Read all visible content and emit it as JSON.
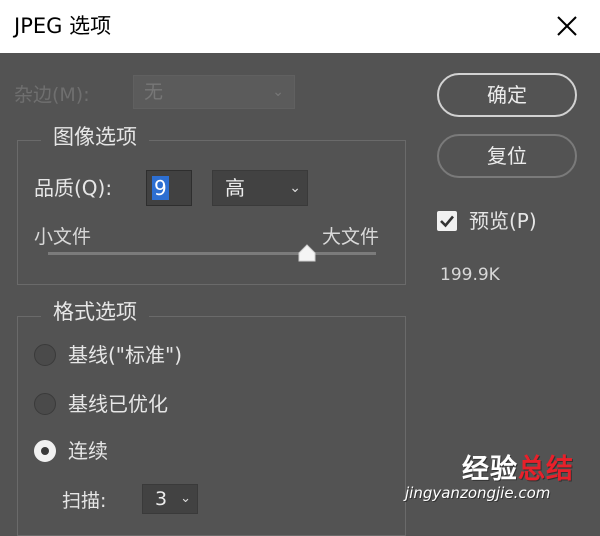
{
  "window": {
    "title": "JPEG 选项",
    "close_icon": "close-icon"
  },
  "matte": {
    "label": "杂边(M):",
    "value": "无",
    "disabled": true
  },
  "image_options": {
    "group_title": "图像选项",
    "quality_label": "品质(Q):",
    "quality_value": "9",
    "quality_level": "高",
    "slider_small_label": "小文件",
    "slider_large_label": "大文件",
    "slider_value_fraction": 0.79
  },
  "format_options": {
    "group_title": "格式选项",
    "options": [
      {
        "label": "基线(\"标准\")",
        "checked": false
      },
      {
        "label": "基线已优化",
        "checked": false
      },
      {
        "label": "连续",
        "checked": true
      }
    ],
    "scan_label": "扫描:",
    "scan_value": "3"
  },
  "actions": {
    "ok_label": "确定",
    "reset_label": "复位",
    "preview_label": "预览(P)",
    "preview_checked": true,
    "file_size": "199.9K"
  },
  "watermark": {
    "logo_part1": "经验",
    "logo_part2": "总结",
    "url": "jingyanzongjie.com"
  },
  "colors": {
    "dialog_bg": "#535353",
    "selection": "#2d6fd2",
    "titlebar_bg": "#ffffff"
  }
}
